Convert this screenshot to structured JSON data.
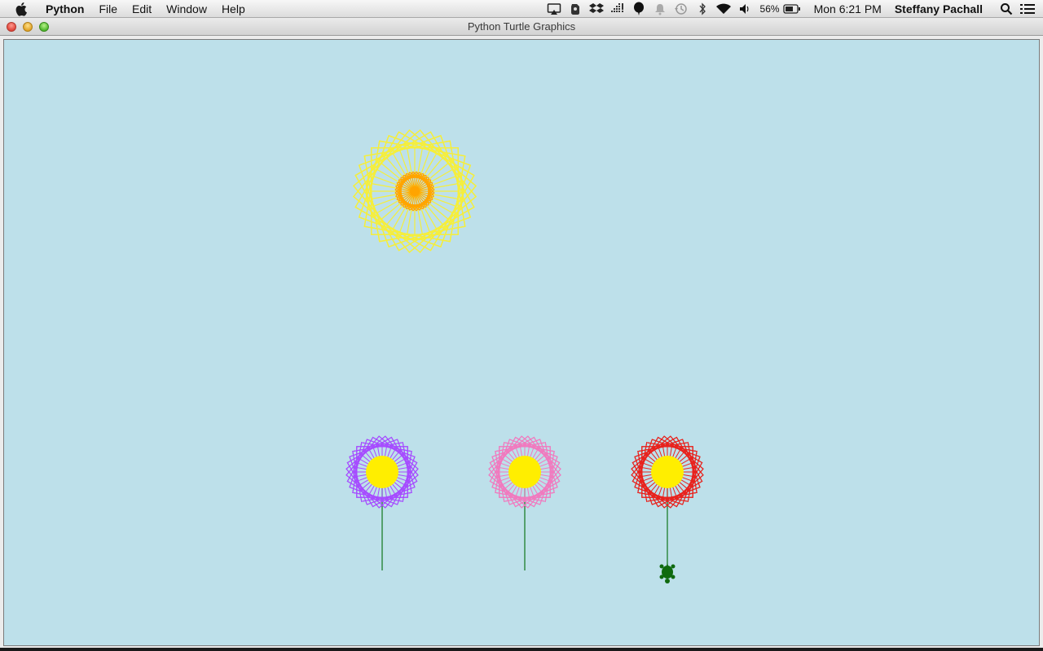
{
  "menubar": {
    "apple_icon": "apple-logo-icon",
    "app_name": "Python",
    "items": [
      "File",
      "Edit",
      "Window",
      "Help"
    ],
    "tray_icons": [
      "airplay-icon",
      "evernote-icon",
      "dropbox-icon",
      "grid-icon",
      "balloon-icon",
      "notification-bell-icon",
      "time-machine-icon",
      "bluetooth-icon",
      "wifi-icon",
      "volume-icon"
    ],
    "battery_percent": "56%",
    "clock": "Mon 6:21 PM",
    "user": "Steffany Pachall",
    "search_icon": "spotlight-search-icon",
    "list_icon": "notification-center-icon"
  },
  "window": {
    "title": "Python Turtle Graphics",
    "background": "#bde0ea"
  },
  "drawing": {
    "sun": {
      "outer_color": "#f5ee3c",
      "inner_color": "#ffa400"
    },
    "flowers": [
      {
        "petal_color": "#a64dff",
        "center_color": "#ffee00",
        "stem_color": "#1c7d2a"
      },
      {
        "petal_color": "#f07bbf",
        "center_color": "#ffee00",
        "stem_color": "#1c7d2a"
      },
      {
        "petal_color": "#e8231e",
        "center_color": "#ffee00",
        "stem_color": "#1c7d2a"
      }
    ],
    "turtle_color": "#0f6a0f"
  }
}
